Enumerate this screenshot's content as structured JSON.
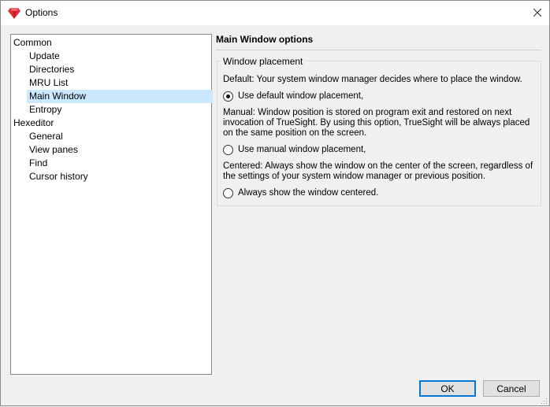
{
  "window": {
    "title": "Options"
  },
  "tree": {
    "items": [
      {
        "label": "Common",
        "level": 0,
        "selected": false
      },
      {
        "label": "Update",
        "level": 1,
        "selected": false
      },
      {
        "label": "Directories",
        "level": 1,
        "selected": false
      },
      {
        "label": "MRU List",
        "level": 1,
        "selected": false
      },
      {
        "label": "Main Window",
        "level": 1,
        "selected": true
      },
      {
        "label": "Entropy",
        "level": 1,
        "selected": false
      },
      {
        "label": "Hexeditor",
        "level": 0,
        "selected": false
      },
      {
        "label": "General",
        "level": 1,
        "selected": false
      },
      {
        "label": "View panes",
        "level": 1,
        "selected": false
      },
      {
        "label": "Find",
        "level": 1,
        "selected": false
      },
      {
        "label": "Cursor history",
        "level": 1,
        "selected": false
      }
    ]
  },
  "panel": {
    "title": "Main Window options",
    "group_label": "Window placement",
    "default_desc": "Default: Your system window manager decides where to place the window.",
    "default_radio": "Use default window placement,",
    "manual_desc": "Manual: Window position is stored on program exit and restored on next invocation of TrueSight. By using this option, TrueSight will be always placed on the same position on the screen.",
    "manual_radio": "Use manual window placement,",
    "centered_desc": "Centered: Always show the window on the center of the screen, regardless of the settings of your system window manager or previous position.",
    "centered_radio": "Always show the window centered.",
    "selected_option": "default"
  },
  "buttons": {
    "ok": "OK",
    "cancel": "Cancel"
  },
  "colors": {
    "selection": "#cce8ff",
    "default_button_border": "#0078d7",
    "icon": "#e0323c"
  },
  "icons": {
    "app": "ruby-gem-icon",
    "close": "close-icon"
  }
}
